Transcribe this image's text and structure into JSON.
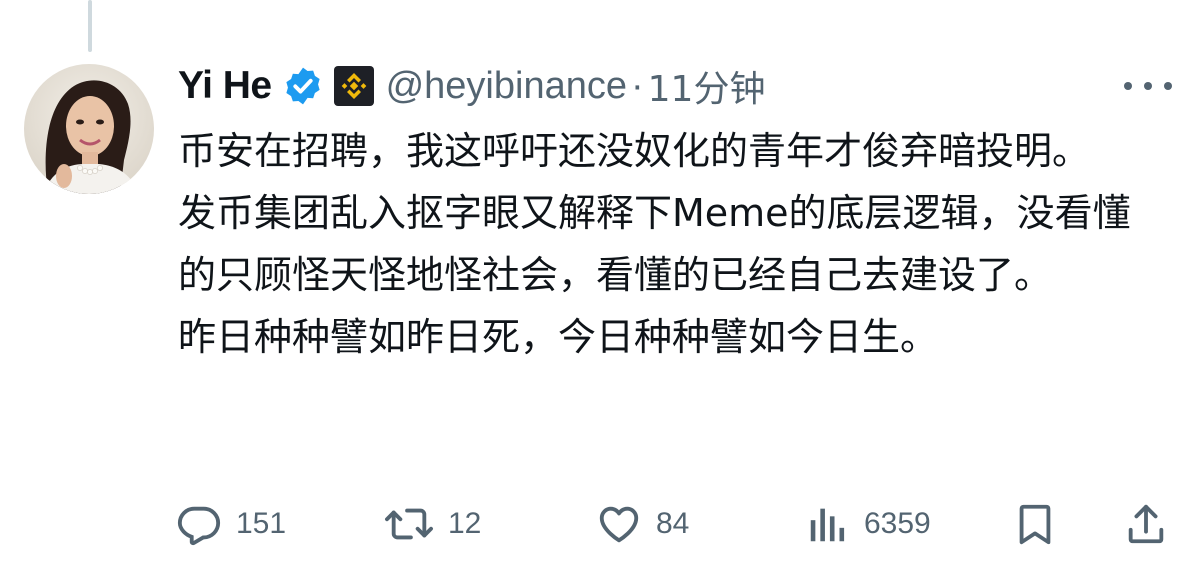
{
  "tweet": {
    "display_name": "Yi He",
    "handle": "@heyibinance",
    "separator": "·",
    "time": "11分钟",
    "body_lines": [
      "币安在招聘，我这呼吁还没奴化的青年才俊弃暗投明。",
      "发币集团乱入抠字眼又解释下Meme的底层逻辑，没看懂的只顾怪天怪地怪社会，看懂的已经自己去建设了。",
      "昨日种种譬如昨日死，今日种种譬如今日生。"
    ]
  },
  "actions": {
    "reply_count": "151",
    "retweet_count": "12",
    "like_count": "84",
    "views_count": "6359"
  },
  "icons": {
    "verified": "verified-badge-icon",
    "affiliate": "binance-logo-icon",
    "more": "more-options-icon",
    "reply": "reply-icon",
    "retweet": "retweet-icon",
    "like": "heart-icon",
    "views": "views-icon",
    "bookmark": "bookmark-icon",
    "share": "share-icon"
  },
  "colors": {
    "verified_blue": "#1d9bf0",
    "binance_yellow": "#f0b90b",
    "secondary_text": "#536471",
    "primary_text": "#0f1419"
  }
}
